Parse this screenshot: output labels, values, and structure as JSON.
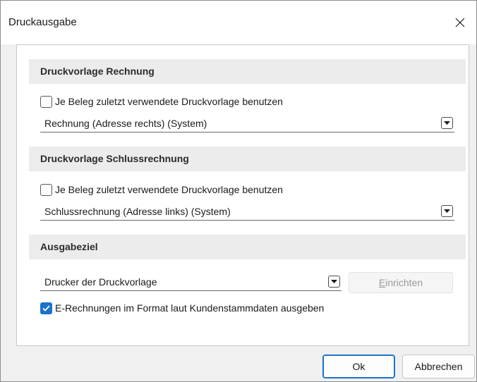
{
  "window": {
    "title": "Druckausgabe"
  },
  "section_invoice": {
    "header": "Druckvorlage Rechnung",
    "checkbox_label": "Je Beleg zuletzt verwendete Druckvorlage benutzen",
    "checkbox_checked": false,
    "template_value": "Rechnung (Adresse rechts) (System)"
  },
  "section_final": {
    "header": "Druckvorlage Schlussrechnung",
    "checkbox_label": "Je Beleg zuletzt verwendete Druckvorlage benutzen",
    "checkbox_checked": false,
    "template_value": "Schlussrechnung (Adresse links) (System)"
  },
  "section_output": {
    "header": "Ausgabeziel",
    "target_value": "Drucker der Druckvorlage",
    "setup_label_prefix": "",
    "setup_label_mnemonic": "E",
    "setup_label_rest": "inrichten",
    "setup_enabled": false,
    "erechnung_label": "E-Rechnungen im Format laut Kundenstammdaten ausgeben",
    "erechnung_checked": true
  },
  "footer": {
    "ok_label": "Ok",
    "cancel_label": "Abbrechen"
  },
  "colors": {
    "accent": "#1a73c8",
    "section_bg": "#ececec",
    "dialog_bg": "#f0f0f0"
  }
}
